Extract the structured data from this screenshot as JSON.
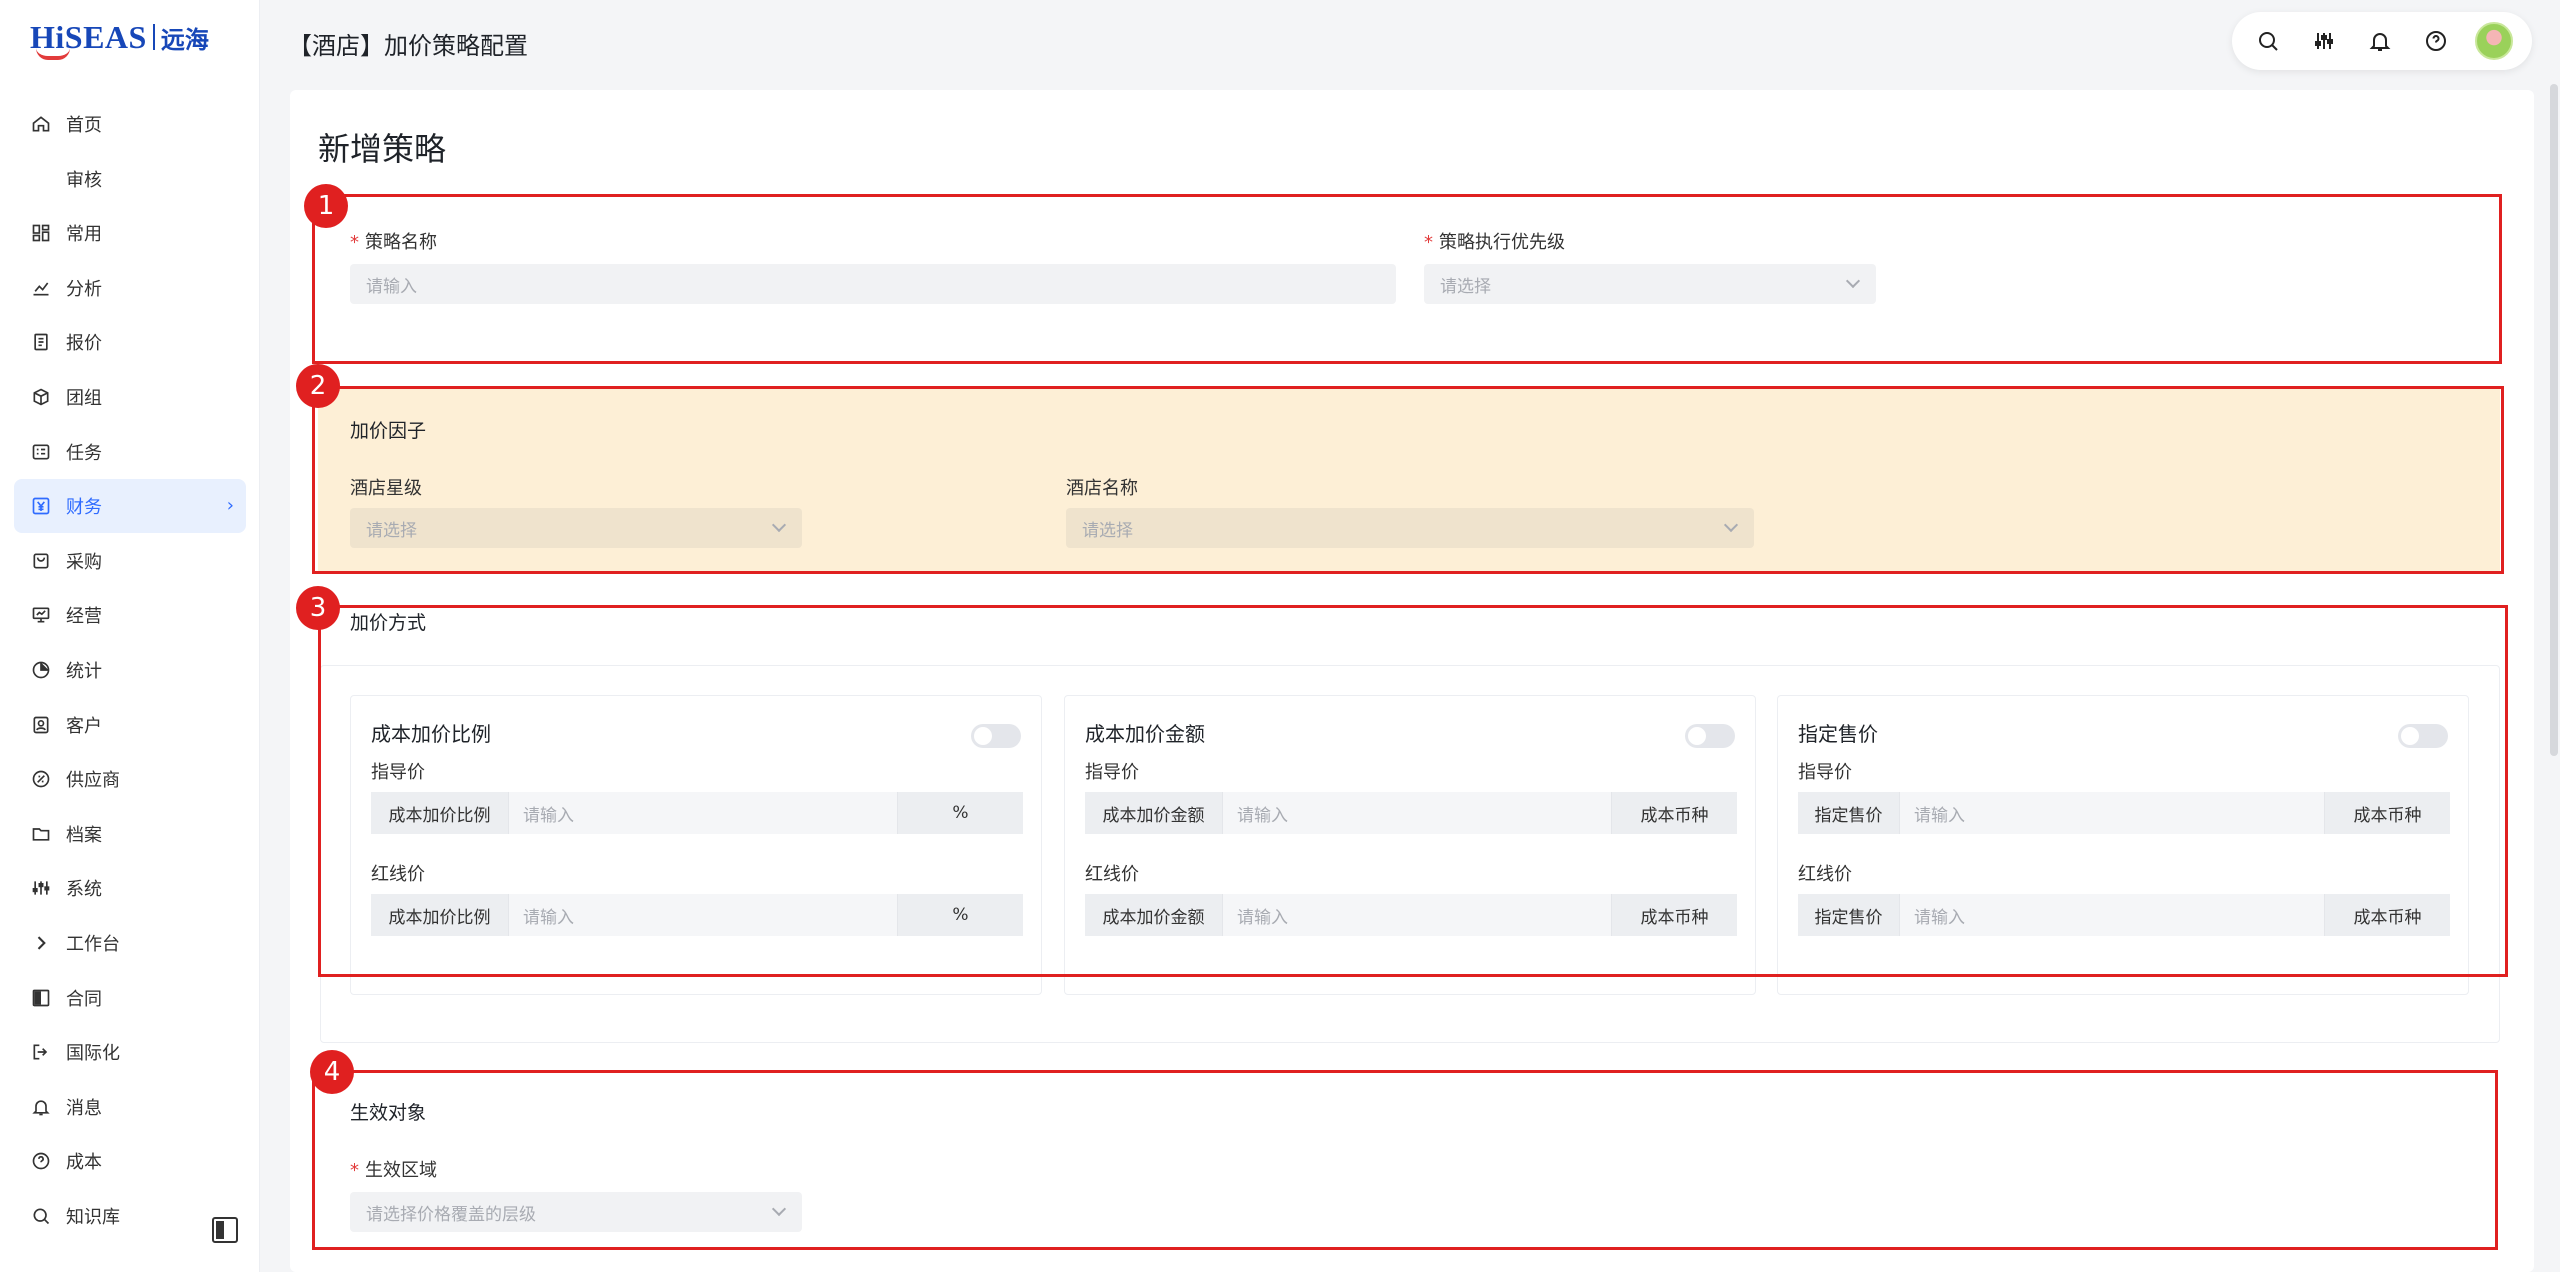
{
  "logo": {
    "brand": "HiSEAS",
    "cn": "远海"
  },
  "header": {
    "title": "【酒店】加价策略配置"
  },
  "sidebar": {
    "items": [
      {
        "label": "首页",
        "icon": "home-icon"
      },
      {
        "label": "审核",
        "icon": ""
      },
      {
        "label": "常用",
        "icon": "grid-icon"
      },
      {
        "label": "分析",
        "icon": "chart-icon"
      },
      {
        "label": "报价",
        "icon": "document-icon"
      },
      {
        "label": "团组",
        "icon": "cube-icon"
      },
      {
        "label": "任务",
        "icon": "task-icon"
      },
      {
        "label": "财务",
        "icon": "yen-icon"
      },
      {
        "label": "采购",
        "icon": "bag-icon"
      },
      {
        "label": "经营",
        "icon": "monitor-icon"
      },
      {
        "label": "统计",
        "icon": "pie-icon"
      },
      {
        "label": "客户",
        "icon": "contact-icon"
      },
      {
        "label": "供应商",
        "icon": "link-icon"
      },
      {
        "label": "档案",
        "icon": "folder-icon"
      },
      {
        "label": "系统",
        "icon": "sliders-icon"
      },
      {
        "label": "工作台",
        "icon": "chevron-right-icon"
      },
      {
        "label": "合同",
        "icon": "panel-icon"
      },
      {
        "label": "国际化",
        "icon": "logout-icon"
      },
      {
        "label": "消息",
        "icon": "bell-icon"
      },
      {
        "label": "成本",
        "icon": "help-icon"
      },
      {
        "label": "知识库",
        "icon": "search-icon"
      }
    ],
    "active_index": 7,
    "active_arrow": "›"
  },
  "form": {
    "title": "新增策略",
    "strategy_name": {
      "label": "策略名称",
      "placeholder": "请输入"
    },
    "priority": {
      "label": "策略执行优先级",
      "placeholder": "请选择"
    },
    "factor": {
      "title": "加价因子",
      "star": {
        "label": "酒店星级",
        "placeholder": "请选择"
      },
      "hotel": {
        "label": "酒店名称",
        "placeholder": "请选择"
      }
    },
    "method": {
      "title": "加价方式",
      "cards": [
        {
          "title": "成本加价比例",
          "guide": "指导价",
          "red": "红线价",
          "prefix": "成本加价比例",
          "placeholder": "请输入",
          "suffix": "%"
        },
        {
          "title": "成本加价金额",
          "guide": "指导价",
          "red": "红线价",
          "prefix": "成本加价金额",
          "placeholder": "请输入",
          "suffix": "成本币种"
        },
        {
          "title": "指定售价",
          "guide": "指导价",
          "red": "红线价",
          "prefix": "指定售价",
          "placeholder": "请输入",
          "suffix": "成本币种"
        }
      ]
    },
    "target": {
      "title": "生效对象",
      "region": {
        "label": "生效区域",
        "placeholder": "请选择价格覆盖的层级"
      }
    }
  },
  "annotations": [
    "1",
    "2",
    "3",
    "4"
  ],
  "colors": {
    "accent": "#2f6bff",
    "annotation": "#e02020",
    "factor_bg": "#fdefd6"
  }
}
